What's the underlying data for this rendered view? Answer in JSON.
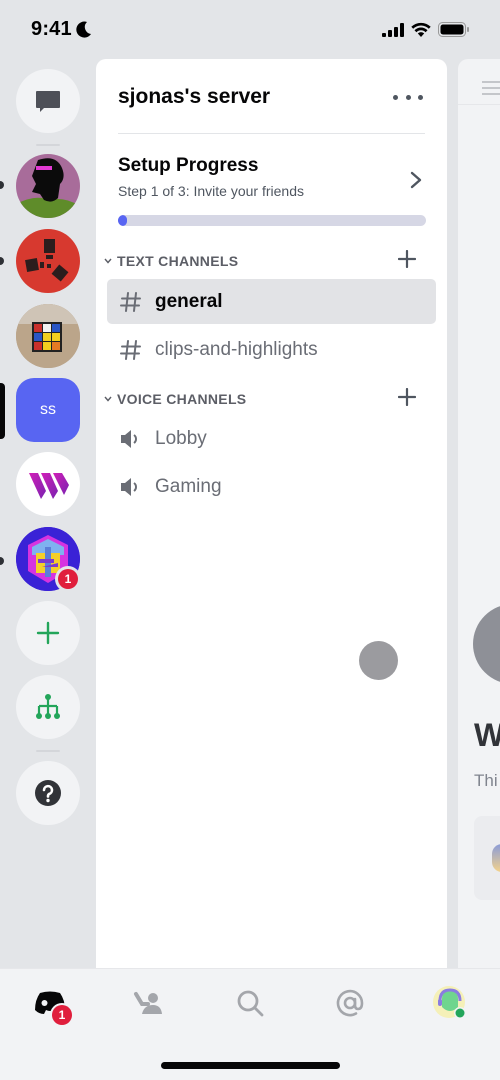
{
  "status_bar": {
    "time": "9:41",
    "focus_icon": "moon-icon",
    "icons": [
      "cellular-signal-icon",
      "wifi-icon",
      "battery-icon"
    ]
  },
  "server_rail": {
    "direct_messages": {
      "icon": "chat-bubble-icon",
      "label": "Direct Messages"
    },
    "servers": [
      {
        "name": "server-avatar-silhouette",
        "unread": true,
        "selected": false
      },
      {
        "name": "server-avatar-rust",
        "unread": true,
        "selected": false
      },
      {
        "name": "server-avatar-rubiks-cube",
        "unread": false,
        "selected": false
      },
      {
        "name": "sjonas's server",
        "initials": "ss",
        "unread": false,
        "selected": true,
        "color": "#5865f2"
      },
      {
        "name": "server-avatar-w-logo",
        "unread": false,
        "selected": false
      },
      {
        "name": "server-avatar-hex-logo",
        "unread": true,
        "selected": false,
        "mentions": "1"
      }
    ],
    "add_server": {
      "icon": "plus-icon",
      "color": "#23a55a"
    },
    "discover": {
      "icon": "hub-tree-icon",
      "color": "#23a55a"
    },
    "help": {
      "icon": "question-icon"
    }
  },
  "channel_panel": {
    "server_name": "sjonas's server",
    "more_icon": "ellipsis-icon",
    "setup": {
      "title": "Setup Progress",
      "subtitle": "Step 1 of 3: Invite your friends",
      "progress_fraction": 0.0,
      "accent": "#5865f2"
    },
    "categories": [
      {
        "label": "TEXT CHANNELS",
        "channels": [
          {
            "name": "general",
            "type": "text",
            "selected": true
          },
          {
            "name": "clips-and-highlights",
            "type": "text",
            "selected": false
          }
        ]
      },
      {
        "label": "VOICE CHANNELS",
        "channels": [
          {
            "name": "Lobby",
            "type": "voice",
            "selected": false
          },
          {
            "name": "Gaming",
            "type": "voice",
            "selected": false
          }
        ]
      }
    ]
  },
  "chat_peek": {
    "title_fragment": "W",
    "subtitle_fragment": "Thi"
  },
  "tab_bar": {
    "tabs": [
      {
        "name": "home",
        "icon": "discord-home-icon",
        "badge": "1",
        "active": true
      },
      {
        "name": "friends",
        "icon": "friends-icon",
        "active": false
      },
      {
        "name": "search",
        "icon": "search-icon",
        "active": false
      },
      {
        "name": "mentions",
        "icon": "at-sign-icon",
        "active": false
      },
      {
        "name": "profile",
        "icon": "user-avatar",
        "active": false,
        "status": "online"
      }
    ]
  }
}
